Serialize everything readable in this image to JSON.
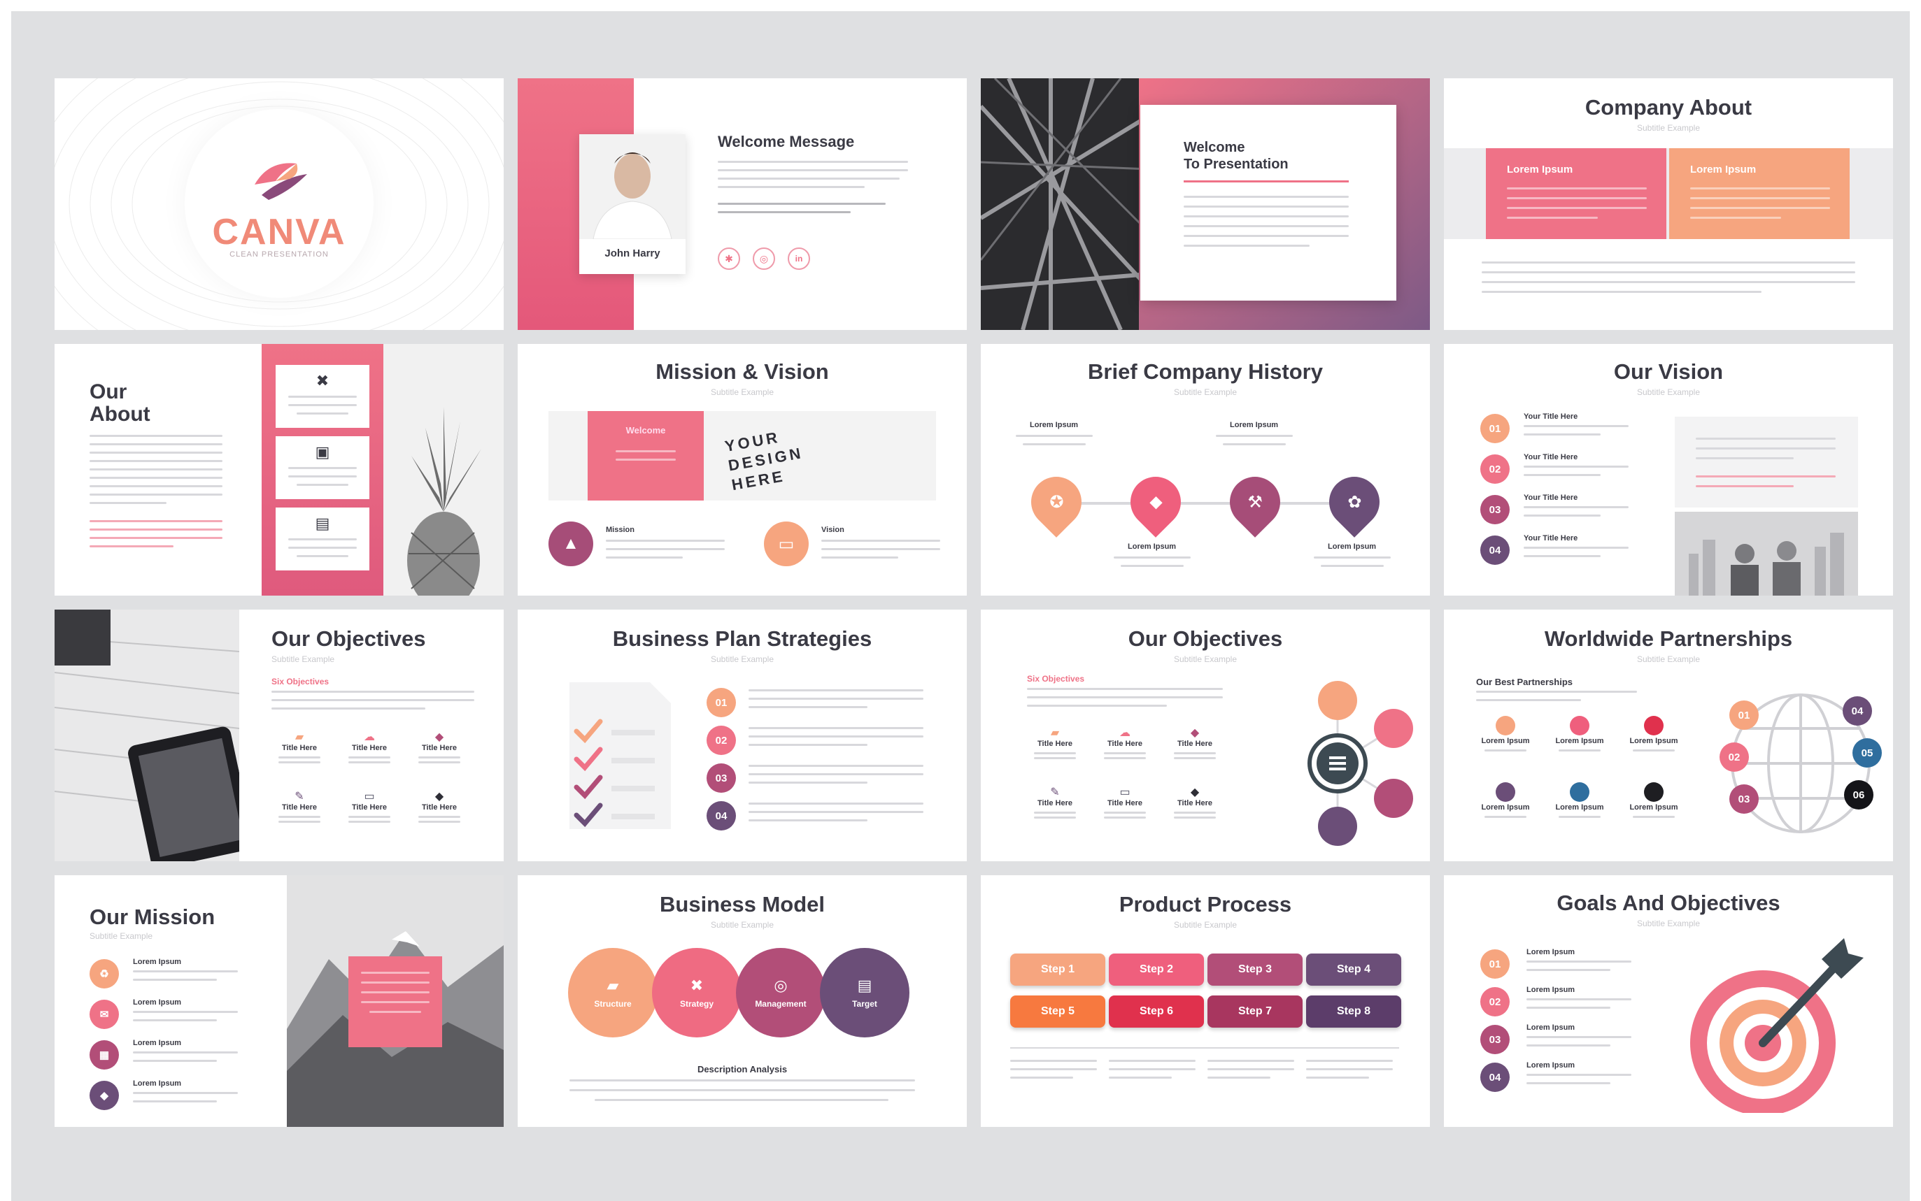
{
  "brand": {
    "name": "CANVA",
    "tagline": "CLEAN PRESENTATION"
  },
  "colors": {
    "pink": "#ef7287",
    "peach": "#f6a57f",
    "plum": "#b24e78",
    "purple": "#6b4e78",
    "red": "#e0314d",
    "board": "#dfe0e2"
  },
  "subtitle": "Subtitle Example",
  "lorem": "Lorem Ipsum",
  "title_here": "Title Here",
  "your_title": "Your Title Here",
  "nums": [
    "01",
    "02",
    "03",
    "04",
    "05",
    "06"
  ],
  "s2": {
    "title": "Welcome Message",
    "name": "John Harry"
  },
  "s3": {
    "title_line1": "Welcome",
    "title_line2": "To Presentation"
  },
  "s4": {
    "title": "Company About"
  },
  "s5": {
    "title_line1": "Our",
    "title_line2": "About"
  },
  "s6": {
    "title": "Mission & Vision",
    "card": "Welcome",
    "board": "YOUR DESIGN HERE",
    "mission": "Mission",
    "vision": "Vision"
  },
  "s7": {
    "title": "Brief Company History"
  },
  "s8": {
    "title": "Our Vision"
  },
  "s9": {
    "title": "Our Objectives",
    "label": "Six Objectives"
  },
  "s10": {
    "title": "Business Plan Strategies"
  },
  "s11": {
    "title": "Our Objectives",
    "label": "Six Objectives"
  },
  "s12": {
    "title": "Worldwide Partnerships",
    "label": "Our Best Partnerships"
  },
  "s13": {
    "title": "Our Mission"
  },
  "s14": {
    "title": "Business Model",
    "circles": [
      "Structure",
      "Strategy",
      "Management",
      "Target"
    ],
    "caption": "Description Analysis"
  },
  "s15": {
    "title": "Product Process",
    "steps": [
      "Step 1",
      "Step 2",
      "Step 3",
      "Step 4",
      "Step 5",
      "Step 6",
      "Step 7",
      "Step 8"
    ]
  },
  "s16": {
    "title": "Goals And Objectives"
  },
  "icons": [
    "brand-logo-icon",
    "person-photo",
    "share-icon",
    "instagram-icon",
    "linkedin-icon",
    "pineapple-image",
    "mountain-icon",
    "monitor-icon",
    "rocket-icon",
    "tag-icon",
    "gavel-icon",
    "gear-icon",
    "checklist-icon",
    "globe-icon",
    "target-arrow-icon",
    "folder-icon",
    "bulb-icon"
  ]
}
